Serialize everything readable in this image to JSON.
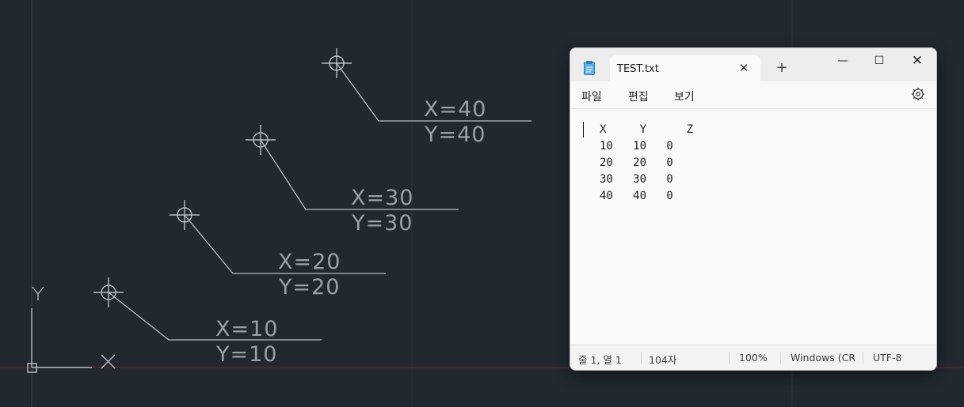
{
  "cad": {
    "points": [
      {
        "x_label": "X=10",
        "y_label": "Y=10"
      },
      {
        "x_label": "X=20",
        "y_label": "Y=20"
      },
      {
        "x_label": "X=30",
        "y_label": "Y=30"
      },
      {
        "x_label": "X=40",
        "y_label": "Y=40"
      }
    ],
    "ucs": {
      "y_label": "Y",
      "x_label": "X"
    },
    "colors": {
      "background": "#212830",
      "grid": "#2c333d",
      "x_axis_line": "#6b2a2c",
      "y_axis_line": "#2d4a36",
      "geometry": "#b9bec5"
    }
  },
  "notepad": {
    "tab_title": "TEST.txt",
    "tab_close": "✕",
    "new_tab": "+",
    "window_controls": {
      "minimize": "—",
      "maximize": "☐",
      "close": "✕"
    },
    "menu": {
      "file": "파일",
      "edit": "편집",
      "view": "보기"
    },
    "lines": [
      "X     Y      Z",
      "10   10   0",
      "20   20   0",
      "30   30   0",
      "40   40   0"
    ],
    "status": {
      "position": "줄 1, 열 1",
      "chars": "104자",
      "zoom": "100%",
      "line_ending": "Windows (CRLF)",
      "encoding": "UTF-8"
    }
  }
}
